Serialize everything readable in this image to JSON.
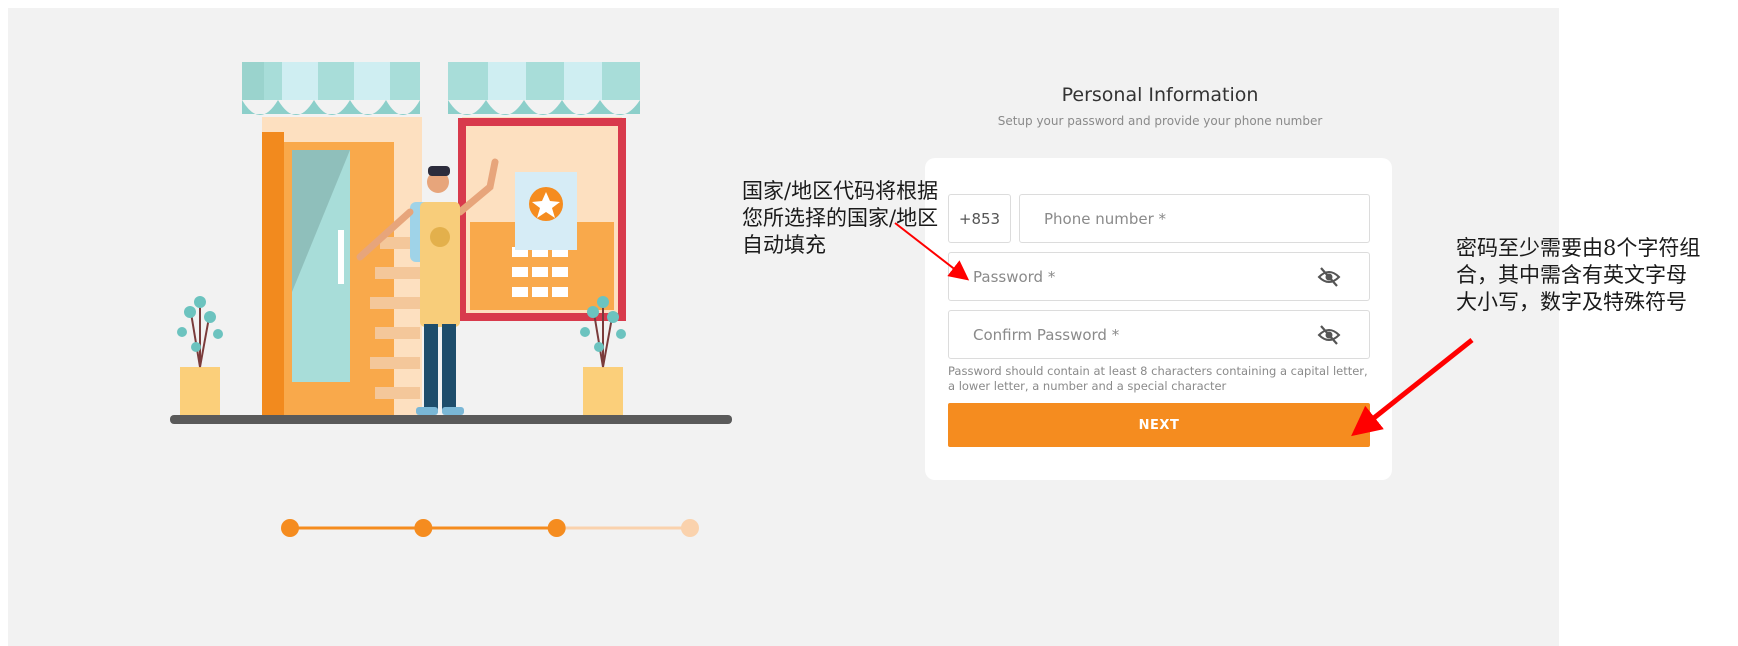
{
  "form": {
    "title": "Personal Information",
    "subtitle": "Setup your password and provide your phone number",
    "country_code": "+853",
    "phone_placeholder": "Phone number *",
    "password_placeholder": "Password *",
    "confirm_password_placeholder": "Confirm Password *",
    "password_hint": "Password should contain at least 8 characters containing a capital letter, a lower letter, a number and a special character",
    "next_label": "NEXT",
    "visibility_icon": "eye-slash-icon"
  },
  "stepper": {
    "total_steps": 4,
    "completed_steps": 3,
    "active_color": "#f58c1f",
    "inactive_color": "#fad2ad"
  },
  "annotations": {
    "country_code_note": "国家/地区代码将根据\n您所选择的国家/地区\n自动填充",
    "password_note": "密码至少需要由8个字符组\n合，其中需含有英文字母\n大小写，数字及特殊符号",
    "arrow_color": "#ff0000"
  },
  "colors": {
    "accent": "#f58c1f",
    "background": "#f2f2f2",
    "card": "#ffffff"
  }
}
